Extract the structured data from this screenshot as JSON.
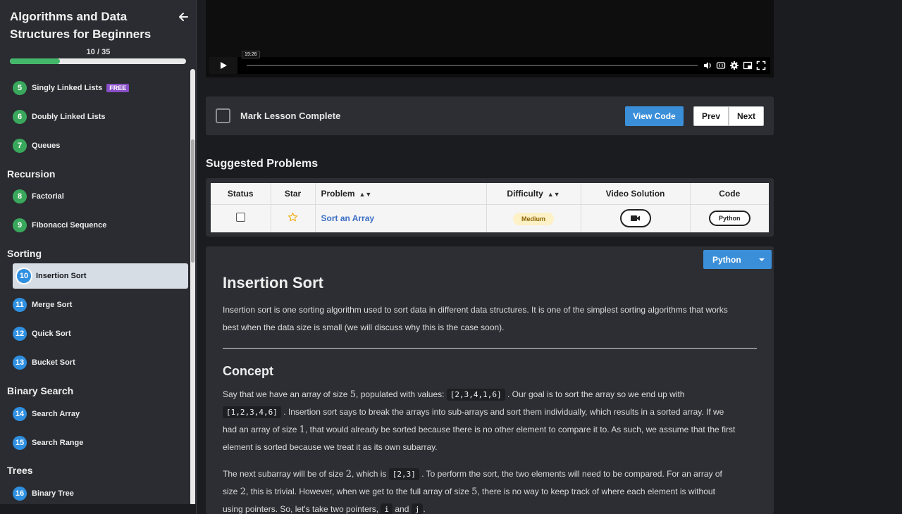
{
  "course": {
    "title": "Algorithms and Data Structures for Beginners",
    "progress_text": "10 / 35",
    "progress_fraction": 0.2857
  },
  "sidebar": {
    "lessons": [
      {
        "num": "5",
        "label": "Singly Linked Lists",
        "badge": "FREE"
      },
      {
        "num": "6",
        "label": "Doubly Linked Lists"
      },
      {
        "num": "7",
        "label": "Queues"
      },
      {
        "num": "8",
        "label": "Factorial"
      },
      {
        "num": "9",
        "label": "Fibonacci Sequence"
      },
      {
        "num": "10",
        "label": "Insertion Sort"
      },
      {
        "num": "11",
        "label": "Merge Sort"
      },
      {
        "num": "12",
        "label": "Quick Sort"
      },
      {
        "num": "13",
        "label": "Bucket Sort"
      },
      {
        "num": "14",
        "label": "Search Array"
      },
      {
        "num": "15",
        "label": "Search Range"
      },
      {
        "num": "16",
        "label": "Binary Tree"
      }
    ],
    "sections": [
      "Recursion",
      "Sorting",
      "Binary Search",
      "Trees"
    ]
  },
  "video": {
    "time_tooltip": "19:26"
  },
  "lesson_bar": {
    "mark_complete": "Mark Lesson Complete",
    "view_code": "View Code",
    "prev": "Prev",
    "next": "Next"
  },
  "suggested": {
    "title": "Suggested Problems",
    "headers": {
      "status": "Status",
      "star": "Star",
      "problem": "Problem",
      "difficulty": "Difficulty",
      "video": "Video Solution",
      "code": "Code"
    },
    "row": {
      "problem": "Sort an Array",
      "difficulty": "Medium",
      "code": "Python"
    }
  },
  "article": {
    "language": "Python",
    "title": "Insertion Sort",
    "intro_line1": "Insertion sort is one sorting algorithm used to sort data in different data structures. It is one of the simplest sorting algorithms that works",
    "intro_line2": "best when the data size is small (we will discuss why this is the case soon).",
    "concept_heading": "Concept",
    "p2": {
      "a": "Say that we have an array of size ",
      "n1": "5",
      "b": ", populated with values: ",
      "code1": "[2,3,4,1,6]",
      "c": ". Our goal is to sort the array so we end up with",
      "code2": "[1,2,3,4,6]",
      "d": ". Insertion sort says to break the arrays into sub-arrays and sort them individually, which results in a sorted array. If we",
      "e": "had an array of size ",
      "n2": "1",
      "f": ", that would already be sorted because there is no other element to compare it to. As such, we assume that the first",
      "g": "element is sorted because we treat it as its own subarray."
    },
    "p3": {
      "a": "The next subarray will be of size ",
      "n1": "2",
      "b": ", which is ",
      "code1": "[2,3]",
      "c": ". To perform the sort, the two elements will need to be compared. For an array of",
      "d": "size ",
      "n2": "2",
      "e": ", this is trivial. However, when we get to the full array of size ",
      "n3": "5",
      "f": ", there is no way to keep track of where each element is without",
      "g": "using pointers. So, let's take two pointers, ",
      "code2": "i",
      "h": " and ",
      "code3": "j",
      "i": "."
    }
  },
  "colors": {
    "accent": "#3b8fd9",
    "green": "#3aa85c",
    "free_badge": "#8a4fc7"
  }
}
